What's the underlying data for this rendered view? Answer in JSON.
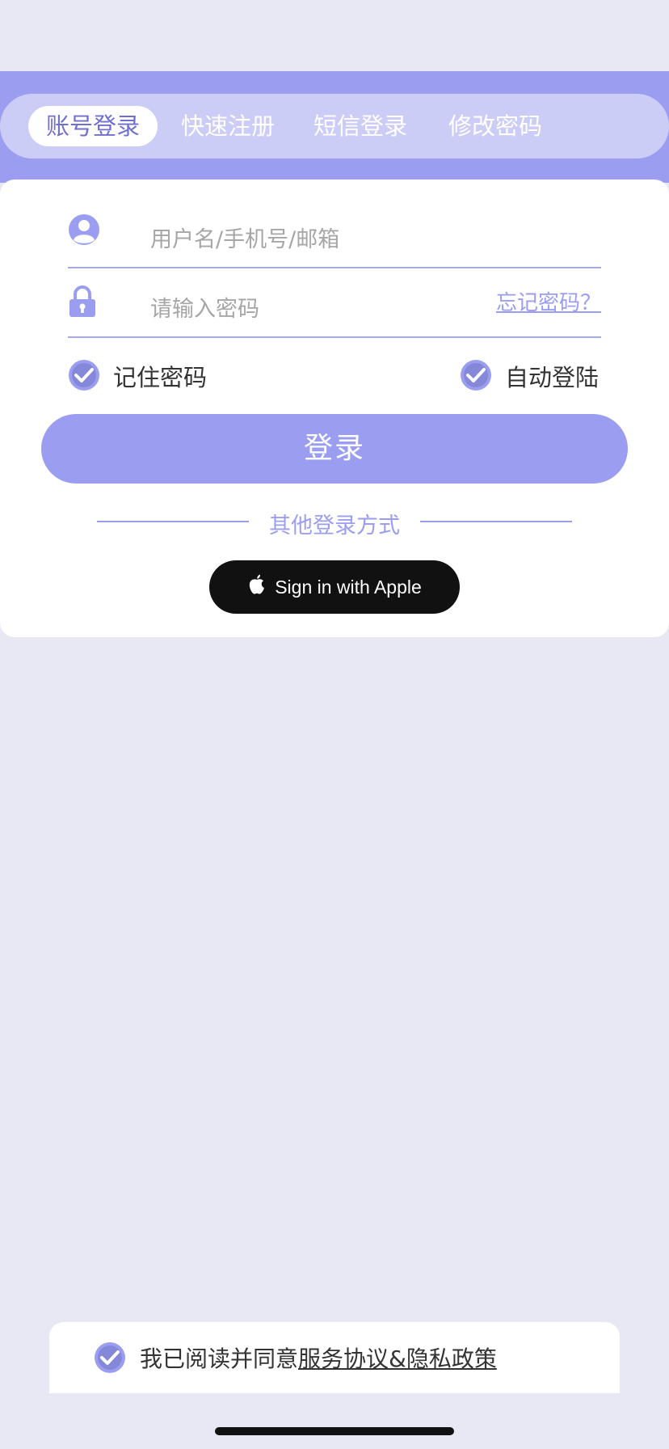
{
  "colors": {
    "page_bg": "#e8e8f4",
    "accent": "#9b9ef0",
    "accent_light": "#cccdf7",
    "active_tab_text": "#6f6fd0",
    "apple_button": "#111111"
  },
  "tabs": [
    {
      "label": "账号登录",
      "active": true
    },
    {
      "label": "快速注册",
      "active": false
    },
    {
      "label": "短信登录",
      "active": false
    },
    {
      "label": "修改密码",
      "active": false
    }
  ],
  "form": {
    "username": {
      "icon": "user-icon",
      "placeholder": "用户名/手机号/邮箱",
      "value": ""
    },
    "password": {
      "icon": "lock-icon",
      "placeholder": "请输入密码",
      "value": ""
    },
    "forgot_label": "忘记密码？"
  },
  "options": {
    "remember": {
      "label": "记住密码",
      "checked": true
    },
    "auto_login": {
      "label": "自动登陆",
      "checked": true
    }
  },
  "login_button": {
    "label": "登录"
  },
  "other_login": {
    "label": "其他登录方式",
    "apple_label": "Sign in with Apple",
    "apple_icon": "apple-icon"
  },
  "agreement": {
    "checked": true,
    "prefix": "我已阅读并同意",
    "link": "服务协议&隐私政策"
  }
}
